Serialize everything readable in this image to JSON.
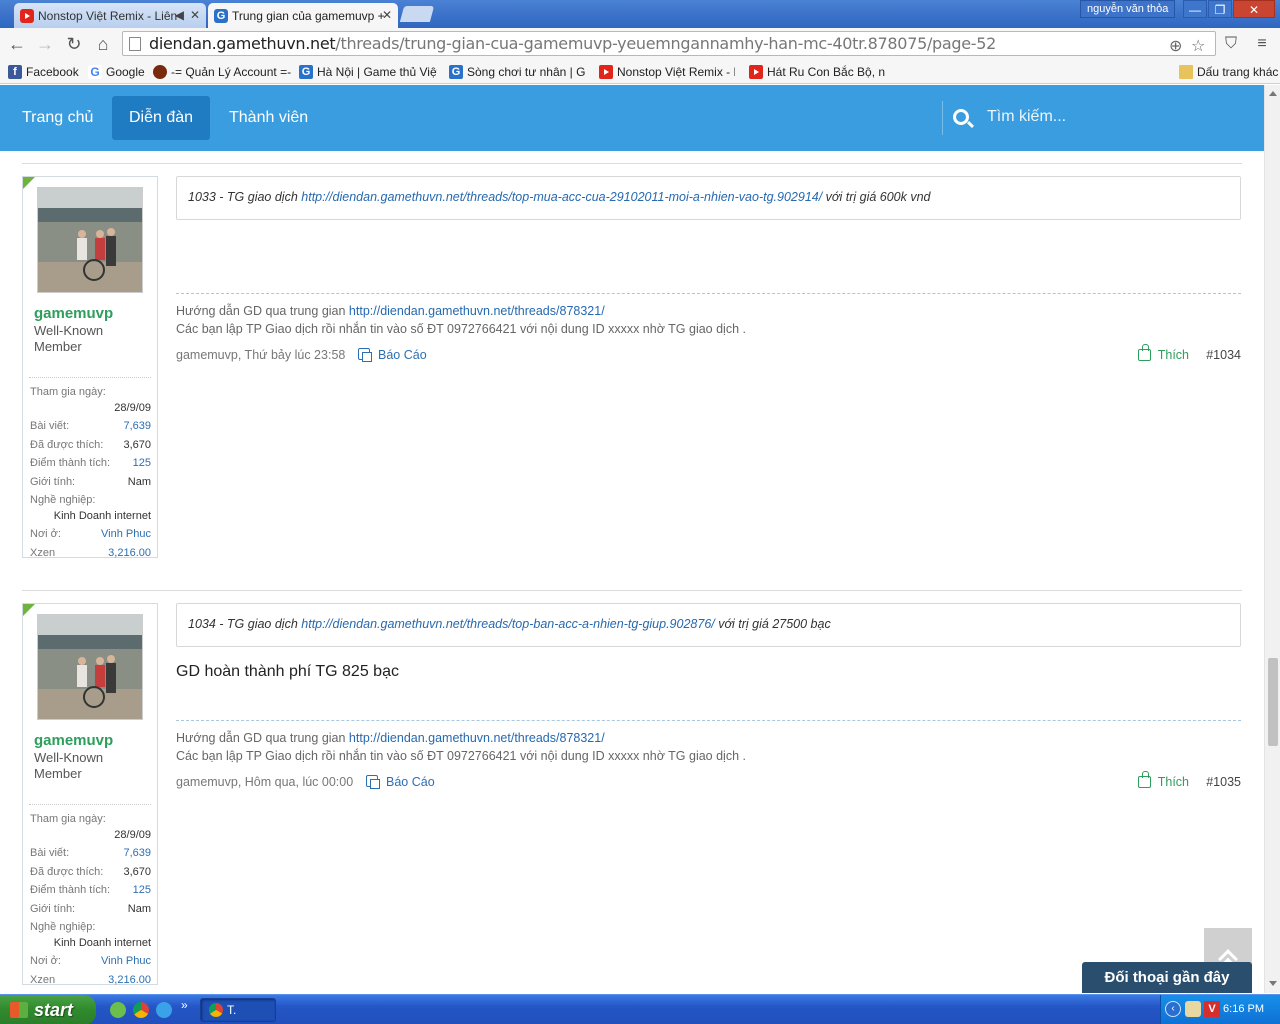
{
  "browser": {
    "tabs": [
      {
        "title": "Nonstop Việt Remix - Liên"
      },
      {
        "title": "Trung gian của gamemuvp +"
      }
    ],
    "user_badge": "nguyễn văn thỏa",
    "url_domain": "diendan.gamethuvn.net",
    "url_path": "/threads/trung-gian-cua-gamemuvp-yeuemngannamhy-han-mc-40tr.878075/page-52",
    "bookmarks": [
      {
        "label": "Facebook"
      },
      {
        "label": "Google"
      },
      {
        "label": "-= Quản Lý Account =-"
      },
      {
        "label": "Hà Nội | Game thủ Việt N"
      },
      {
        "label": "Sòng chơi tư nhân | Gan"
      },
      {
        "label": "Nonstop Việt Remix - Liê"
      },
      {
        "label": "Hát Ru Con Bắc Bộ, nhữ"
      }
    ],
    "other_bookmarks": "Dấu trang khác"
  },
  "site_nav": {
    "items": [
      "Trang chủ",
      "Diễn đàn",
      "Thành viên"
    ],
    "search_placeholder": "Tìm kiếm..."
  },
  "posts": [
    {
      "user": {
        "name": "gamemuvp",
        "title": "Well-Known Member",
        "stats": [
          {
            "label": "Tham gia ngày:",
            "value": "28/9/09"
          },
          {
            "label": "Bài viết:",
            "value": "7,639"
          },
          {
            "label": "Đã được thích:",
            "value": "3,670"
          },
          {
            "label": "Điểm thành tích:",
            "value": "125"
          },
          {
            "label": "Giới tính:",
            "value": "Nam"
          },
          {
            "label": "Nghề nghiệp:",
            "value": "Kinh Doanh internet"
          },
          {
            "label": "Nơi ở:",
            "value": "Vinh Phuc"
          },
          {
            "label": "Xzen",
            "value": "3,216.00"
          }
        ]
      },
      "quote_prefix": "1033 - TG giao dịch ",
      "quote_link": "http://diendan.gamethuvn.net/threads/top-mua-acc-cua-29102011-moi-a-nhien-vao-tg.902914/",
      "quote_suffix": " với trị giá 600k vnd",
      "body": "",
      "sig_line1_prefix": "Hướng dẫn GD qua trung gian ",
      "sig_line1_link": "http://diendan.gamethuvn.net/threads/878321/",
      "sig_line2": "Các bạn lập TP Giao dịch rồi nhắn tin vào số ĐT 0972766421 với nội dung ID xxxxx nhờ TG giao dịch .",
      "meta_author": "gamemuvp, Thứ bảy lúc 23:58",
      "report_label": "Báo Cáo",
      "like_label": "Thích",
      "post_number": "#1034"
    },
    {
      "user": {
        "name": "gamemuvp",
        "title": "Well-Known Member",
        "stats": [
          {
            "label": "Tham gia ngày:",
            "value": "28/9/09"
          },
          {
            "label": "Bài viết:",
            "value": "7,639"
          },
          {
            "label": "Đã được thích:",
            "value": "3,670"
          },
          {
            "label": "Điểm thành tích:",
            "value": "125"
          },
          {
            "label": "Giới tính:",
            "value": "Nam"
          },
          {
            "label": "Nghề nghiệp:",
            "value": "Kinh Doanh internet"
          },
          {
            "label": "Nơi ở:",
            "value": "Vinh Phuc"
          },
          {
            "label": "Xzen",
            "value": "3,216.00"
          }
        ]
      },
      "quote_prefix": "1034 - TG giao dịch ",
      "quote_link": "http://diendan.gamethuvn.net/threads/top-ban-acc-a-nhien-tg-giup.902876/",
      "quote_suffix": " với trị giá 27500 bạc",
      "body": "GD hoàn thành phí TG 825 bạc",
      "sig_line1_prefix": "Hướng dẫn GD qua trung gian ",
      "sig_line1_link": "http://diendan.gamethuvn.net/threads/878321/",
      "sig_line2": "Các bạn lập TP Giao dịch rồi nhắn tin vào số ĐT 0972766421 với nội dung ID xxxxx nhờ TG giao dịch .",
      "meta_author": "gamemuvp, Hôm qua, lúc 00:00",
      "report_label": "Báo Cáo",
      "like_label": "Thích",
      "post_number": "#1035"
    }
  ],
  "chat_bar_label": "Đối thoại gần đây",
  "taskbar": {
    "start_label": "start",
    "task_label": "T.",
    "quick_launch_more": "»",
    "clock": "6:16 PM"
  },
  "colors": {
    "site_nav": "#3a9ddf",
    "site_nav_active": "#1f7cc2",
    "username": "#2e9e5c",
    "link": "#2669b0"
  }
}
